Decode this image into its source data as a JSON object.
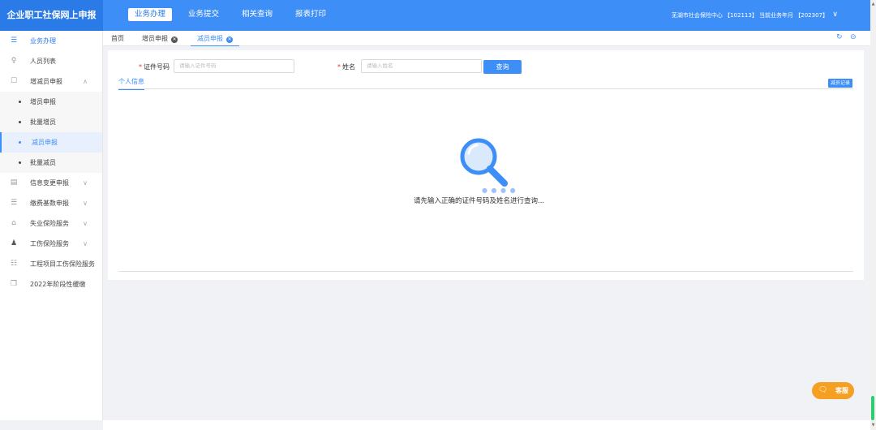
{
  "app": {
    "title": "企业职工社保网上申报"
  },
  "topnav": {
    "items": [
      "业务办理",
      "业务提交",
      "相关查询",
      "报表打印"
    ],
    "active": "业务办理",
    "org_info": "芜湖市社会保险中心 【102113】 当前业务年月 【202307】"
  },
  "sidebar": {
    "header": "业务办理",
    "items": [
      {
        "label": "人员列表",
        "icon": "person-list-icon"
      },
      {
        "label": "增减员申报",
        "icon": "clipboard-icon",
        "expanded": true
      }
    ],
    "subitems": [
      {
        "label": "增员申报"
      },
      {
        "label": "批量增员"
      },
      {
        "label": "减员申报",
        "active": true
      },
      {
        "label": "批量减员"
      }
    ],
    "more": [
      {
        "label": "信息变更申报",
        "icon": "document-edit-icon"
      },
      {
        "label": "缴费基数申报",
        "icon": "list-icon"
      },
      {
        "label": "失业保险服务",
        "icon": "briefcase-icon"
      },
      {
        "label": "工伤保险服务",
        "icon": "user-injury-icon"
      },
      {
        "label": "工程项目工伤保险服务",
        "icon": "org-chart-icon"
      },
      {
        "label": "2022年阶段性缓缴",
        "icon": "copy-icon"
      }
    ]
  },
  "tabs": [
    {
      "label": "首页",
      "closable": false
    },
    {
      "label": "增员申报",
      "closable": true
    },
    {
      "label": "减员申报",
      "closable": true,
      "active": true
    }
  ],
  "form": {
    "id_label": "证件号码",
    "id_placeholder": "请输入证件号码",
    "name_label": "姓名",
    "name_placeholder": "请输入姓名",
    "query_button": "查询"
  },
  "subtab": {
    "label": "个人信息"
  },
  "record_button": "减员记录",
  "empty_hint": "请先输入正确的证件号码及姓名进行查询...",
  "kefu_label": "客服",
  "colors": {
    "primary": "#3d8ef7",
    "kefu": "#f5a023",
    "required": "#e33333"
  }
}
